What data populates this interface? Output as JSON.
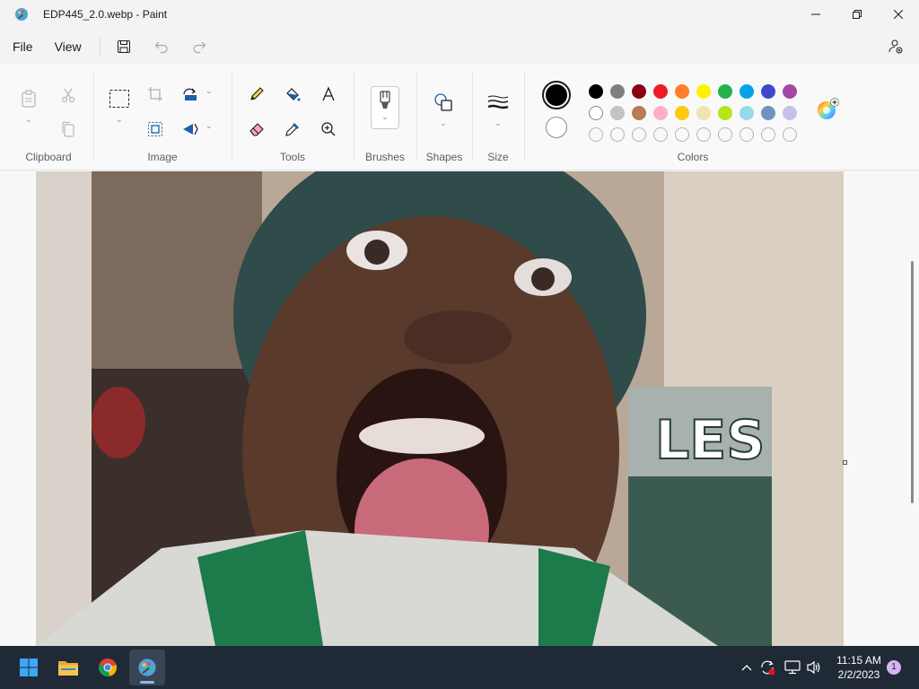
{
  "window": {
    "title": "EDP445_2.0.webp - Paint"
  },
  "menu": {
    "file_label": "File",
    "view_label": "View"
  },
  "ribbon": {
    "groups": {
      "clipboard": "Clipboard",
      "image": "Image",
      "tools": "Tools",
      "brushes": "Brushes",
      "shapes": "Shapes",
      "size": "Size",
      "colors": "Colors"
    },
    "primary_color": "#000000",
    "secondary_color": "#ffffff",
    "palette_row1": [
      "#000000",
      "#7f7f7f",
      "#880015",
      "#ed1c24",
      "#ff7f27",
      "#fff200",
      "#22b14c",
      "#00a2e8",
      "#3f48cc",
      "#a349a4"
    ],
    "palette_row2": [
      "#ffffff",
      "#c3c3c3",
      "#b97a57",
      "#ffaec9",
      "#ffc90e",
      "#efe4b0",
      "#b5e61d",
      "#99d9ea",
      "#7092be",
      "#c8bfe7"
    ],
    "palette_row3_empty_count": 10
  },
  "taskbar": {
    "time": "11:15 AM",
    "date": "2/2/2023",
    "notification_count": "1"
  }
}
